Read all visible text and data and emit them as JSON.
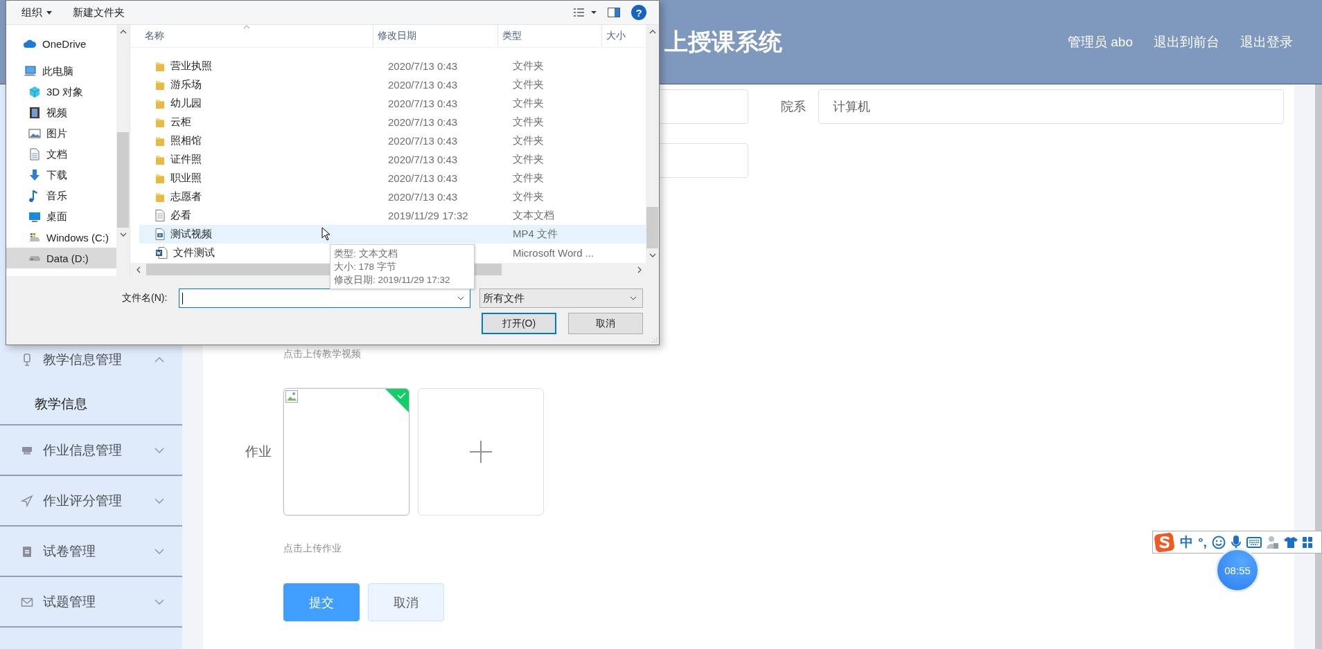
{
  "header": {
    "title": "上授课系统",
    "user": "管理员 abo",
    "links": [
      "退出到前台",
      "退出登录"
    ]
  },
  "sidebar": {
    "items": [
      {
        "label": "教学信息管理",
        "expanded": true,
        "children": [
          {
            "label": "教学信息"
          }
        ]
      },
      {
        "label": "作业信息管理",
        "expanded": false
      },
      {
        "label": "作业评分管理",
        "expanded": false
      },
      {
        "label": "试卷管理",
        "expanded": false
      },
      {
        "label": "试题管理",
        "expanded": false
      }
    ]
  },
  "form": {
    "fields": [
      {
        "label": "院系",
        "value": "计算机"
      }
    ]
  },
  "video_upload": {
    "hint": "点击上传教学视频"
  },
  "homework": {
    "label": "作业",
    "files": [
      {
        "uploaded": true
      }
    ],
    "hint": "点击上传作业"
  },
  "buttons": [
    {
      "label": "提交",
      "kind": "primary"
    },
    {
      "label": "取消",
      "kind": "plain"
    }
  ],
  "dialog": {
    "toolbar": {
      "organize": "组织",
      "new_folder": "新建文件夹",
      "help": "?"
    },
    "nav": [
      {
        "label": "OneDrive",
        "selected": false
      },
      {
        "label": "此电脑",
        "selected": false,
        "children": [
          {
            "label": "3D 对象",
            "selected": false
          },
          {
            "label": "视频",
            "selected": false
          },
          {
            "label": "图片",
            "selected": false
          },
          {
            "label": "文档",
            "selected": false
          },
          {
            "label": "下载",
            "selected": false
          },
          {
            "label": "音乐",
            "selected": false
          },
          {
            "label": "桌面",
            "selected": false
          },
          {
            "label": "Windows (C:)",
            "selected": false
          },
          {
            "label": "Data (D:)",
            "selected": true
          }
        ]
      }
    ],
    "columns": [
      "名称",
      "修改日期",
      "类型",
      "大小"
    ],
    "files": [
      {
        "name": "营业执照",
        "date": "2020/7/13 0:43",
        "type": "文件夹",
        "kind": "folder",
        "hovered": false
      },
      {
        "name": "游乐场",
        "date": "2020/7/13 0:43",
        "type": "文件夹",
        "kind": "folder",
        "hovered": false
      },
      {
        "name": "幼儿园",
        "date": "2020/7/13 0:43",
        "type": "文件夹",
        "kind": "folder",
        "hovered": false
      },
      {
        "name": "云柜",
        "date": "2020/7/13 0:43",
        "type": "文件夹",
        "kind": "folder",
        "hovered": false
      },
      {
        "name": "照相馆",
        "date": "2020/7/13 0:43",
        "type": "文件夹",
        "kind": "folder",
        "hovered": false
      },
      {
        "name": "证件照",
        "date": "2020/7/13 0:43",
        "type": "文件夹",
        "kind": "folder",
        "hovered": false
      },
      {
        "name": "职业照",
        "date": "2020/7/13 0:43",
        "type": "文件夹",
        "kind": "folder",
        "hovered": false
      },
      {
        "name": "志愿者",
        "date": "2020/7/13 0:43",
        "type": "文件夹",
        "kind": "folder",
        "hovered": false
      },
      {
        "name": "必看",
        "date": "2019/11/29 17:32",
        "type": "文本文档",
        "kind": "text",
        "hovered": false
      },
      {
        "name": "测试视频",
        "type": "MP4 文件",
        "kind": "video",
        "hovered": true
      },
      {
        "name": "文件测试",
        "type": "Microsoft Word ...",
        "kind": "word",
        "hovered": false
      }
    ],
    "tooltip": [
      "类型: 文本文档",
      "大小: 178 字节",
      "修改日期: 2019/11/29 17:32"
    ],
    "filename_label": "文件名(N):",
    "filter": "所有文件",
    "open": "打开(O)",
    "cancel": "取消"
  },
  "ime": {
    "mode": "中",
    "punct": "°,"
  },
  "clock": "08:55"
}
